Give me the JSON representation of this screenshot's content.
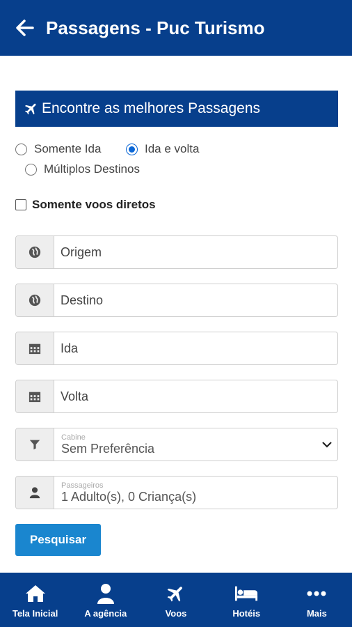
{
  "header": {
    "title": "Passagens - Puc Turismo"
  },
  "banner": {
    "title": "Encontre as melhores Passagens"
  },
  "trip_type": {
    "options": [
      "Somente Ida",
      "Ida e volta",
      "Múltiplos Destinos"
    ],
    "selected": "Ida e volta"
  },
  "direct_flights": {
    "label": "Somente voos diretos",
    "checked": false
  },
  "fields": {
    "origin": {
      "placeholder": "Origem"
    },
    "destination": {
      "placeholder": "Destino"
    },
    "departure": {
      "placeholder": "Ida"
    },
    "return": {
      "placeholder": "Volta"
    },
    "cabin": {
      "label": "Cabine",
      "value": "Sem Preferência"
    },
    "passengers": {
      "label": "Passageiros",
      "value": "1 Adulto(s), 0 Criança(s)"
    }
  },
  "search_button": {
    "label": "Pesquisar"
  },
  "bottom_nav": {
    "items": [
      {
        "label": "Tela Inicial",
        "icon": "home-icon"
      },
      {
        "label": "A agência",
        "icon": "user-icon"
      },
      {
        "label": "Voos",
        "icon": "plane-icon"
      },
      {
        "label": "Hotéis",
        "icon": "bed-icon"
      },
      {
        "label": "Mais",
        "icon": "more-icon"
      }
    ]
  },
  "colors": {
    "primary": "#073f8c",
    "button": "#1a86cf",
    "radio_selected": "#0b67d6"
  }
}
